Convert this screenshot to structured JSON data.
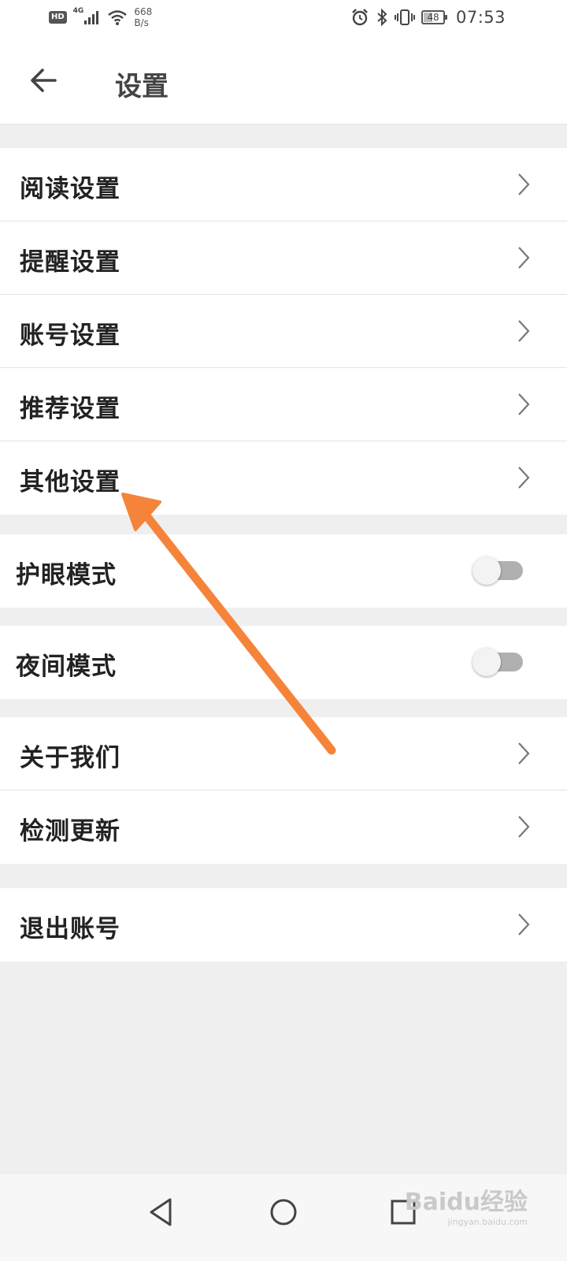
{
  "status_bar": {
    "hd": "HD",
    "network_type": "4G",
    "speed_value": "668",
    "speed_unit": "B/s",
    "battery_level": 48,
    "battery_text": "48",
    "time": "07:53"
  },
  "header": {
    "title": "设置",
    "back_icon": "arrow-left-icon"
  },
  "groups": {
    "main_settings": [
      {
        "label": "阅读设置"
      },
      {
        "label": "提醒设置"
      },
      {
        "label": "账号设置"
      },
      {
        "label": "推荐设置"
      },
      {
        "label": "其他设置"
      }
    ],
    "eye_mode": {
      "label": "护眼模式",
      "on": false
    },
    "night_mode": {
      "label": "夜间模式",
      "on": false
    },
    "about": [
      {
        "label": "关于我们"
      },
      {
        "label": "检测更新"
      }
    ],
    "logout": {
      "label": "退出账号"
    }
  },
  "watermark": {
    "brand": "Baidu经验",
    "url": "jingyan.baidu.com"
  },
  "colors": {
    "annotation_arrow": "#f5843a",
    "toggle_off_track": "#b0b0b0",
    "background": "#efefef"
  }
}
